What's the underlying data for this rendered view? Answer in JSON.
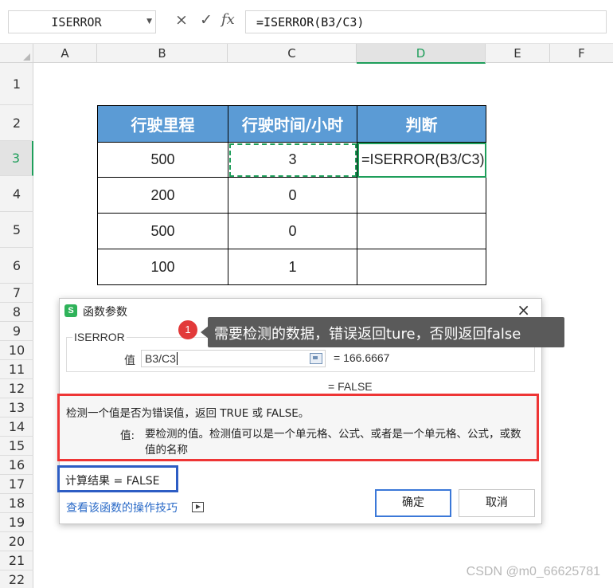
{
  "formula_bar": {
    "name_box": "ISERROR",
    "cancel_icon": "×",
    "enter_icon": "✓",
    "fx_icon": "fx",
    "formula": "=ISERROR(B3/C3)"
  },
  "columns": [
    "A",
    "B",
    "C",
    "D",
    "E",
    "F"
  ],
  "active_column": "D",
  "rows": [
    "1",
    "2",
    "3",
    "4",
    "5",
    "6",
    "7",
    "8",
    "9",
    "10",
    "11",
    "12",
    "13",
    "14",
    "15",
    "16",
    "17",
    "18",
    "19",
    "20",
    "21",
    "22"
  ],
  "active_row": "3",
  "table": {
    "headers": [
      "行驶里程",
      "行驶时间/小时",
      "判断"
    ],
    "rows": [
      [
        "500",
        "3",
        "=ISERROR(B3/C3)"
      ],
      [
        "200",
        "0",
        ""
      ],
      [
        "500",
        "0",
        ""
      ],
      [
        "100",
        "1",
        ""
      ]
    ]
  },
  "dialog": {
    "logo": "S",
    "title": "函数参数",
    "close_icon": "×",
    "function_name": "ISERROR",
    "param_label": "值",
    "param_value": "B3/C3",
    "param_result": "= 166.6667",
    "formula_result": "= FALSE",
    "description": "检测一个值是否为错误值，返回 TRUE 或 FALSE。",
    "param_desc_label": "值:",
    "param_desc_text": "要检测的值。检测值可以是一个单元格、公式、或者是一个单元格、公式，或数值的名称",
    "calc_result": "计算结果 =  FALSE",
    "tips_link": "查看该函数的操作技巧",
    "ok_button": "确定",
    "cancel_button": "取消"
  },
  "annotation": {
    "badge": "1",
    "text": "需要检测的数据，错误返回ture，否则返回false"
  },
  "colors": {
    "header_fill": "#5b9bd5",
    "active_green": "#1e9e5a",
    "highlight_red": "#ee3535",
    "highlight_blue": "#2d5dc4",
    "link_blue": "#2869c7"
  },
  "watermark": "CSDN @m0_66625781"
}
